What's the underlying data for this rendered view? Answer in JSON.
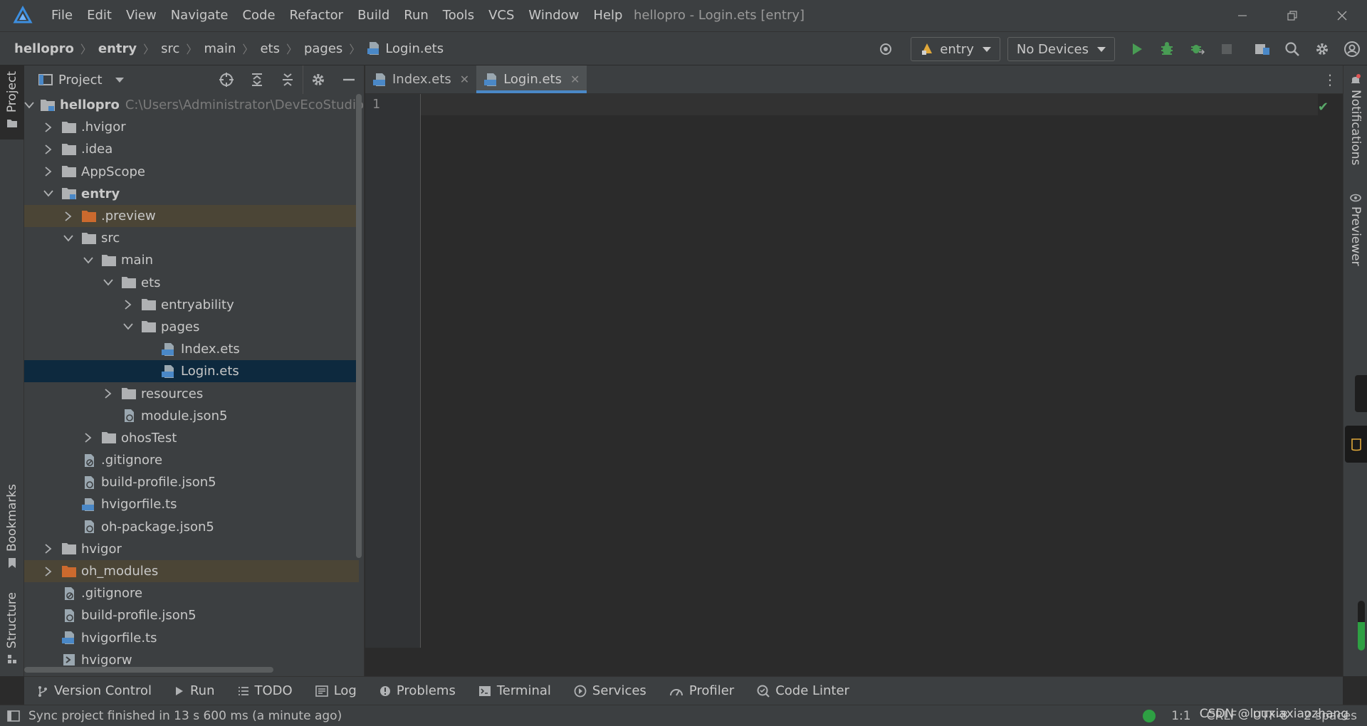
{
  "app": {
    "window_title": "hellopro - Login.ets [entry]",
    "menu": [
      "File",
      "Edit",
      "View",
      "Navigate",
      "Code",
      "Refactor",
      "Build",
      "Run",
      "Tools",
      "VCS",
      "Window",
      "Help"
    ]
  },
  "breadcrumb": {
    "items": [
      "hellopro",
      "entry",
      "src",
      "main",
      "ets",
      "pages",
      "Login.ets"
    ]
  },
  "toolbar": {
    "module_combo": "entry",
    "device_combo": "No Devices",
    "icons": [
      "locate-icon",
      "run-icon",
      "debug-icon",
      "attach-debugger-icon",
      "stop-icon",
      "project-structure-icon",
      "search-icon",
      "settings-icon",
      "account-icon"
    ],
    "colors": {
      "run": "#499c54",
      "accent": "#4a88c7"
    }
  },
  "left_strip": {
    "project": "Project",
    "bookmarks": "Bookmarks",
    "structure": "Structure"
  },
  "right_strip": {
    "notifications": "Notifications",
    "previewer": "Previewer"
  },
  "project_panel": {
    "title": "Project",
    "tree": [
      {
        "label": "hellopro",
        "path": "C:\\Users\\Administrator\\DevEcoStudioProjects\\hellopro",
        "type": "module",
        "expanded": true,
        "bold": true
      },
      {
        "label": ".hvigor",
        "type": "folder",
        "expanded": false
      },
      {
        "label": ".idea",
        "type": "folder",
        "expanded": false
      },
      {
        "label": "AppScope",
        "type": "folder",
        "expanded": false
      },
      {
        "label": "entry",
        "type": "module",
        "expanded": true,
        "bold": true
      },
      {
        "label": ".preview",
        "type": "folder-orange",
        "expanded": false
      },
      {
        "label": "src",
        "type": "folder",
        "expanded": true
      },
      {
        "label": "main",
        "type": "folder",
        "expanded": true
      },
      {
        "label": "ets",
        "type": "folder",
        "expanded": true
      },
      {
        "label": "entryability",
        "type": "folder",
        "expanded": false
      },
      {
        "label": "pages",
        "type": "folder",
        "expanded": true
      },
      {
        "label": "Index.ets",
        "type": "ets-file"
      },
      {
        "label": "Login.ets",
        "type": "ets-file"
      },
      {
        "label": "resources",
        "type": "folder",
        "expanded": false
      },
      {
        "label": "module.json5",
        "type": "json-file"
      },
      {
        "label": "ohosTest",
        "type": "folder",
        "expanded": false
      },
      {
        "label": ".gitignore",
        "type": "ignore-file"
      },
      {
        "label": "build-profile.json5",
        "type": "json-file"
      },
      {
        "label": "hvigorfile.ts",
        "type": "ts-file"
      },
      {
        "label": "oh-package.json5",
        "type": "json-file"
      },
      {
        "label": "hvigor",
        "type": "folder",
        "expanded": false
      },
      {
        "label": "oh_modules",
        "type": "folder-orange",
        "expanded": false
      },
      {
        "label": ".gitignore",
        "type": "ignore-file"
      },
      {
        "label": "build-profile.json5",
        "type": "json-file"
      },
      {
        "label": "hvigorfile.ts",
        "type": "ts-file"
      },
      {
        "label": "hvigorw",
        "type": "exec-file"
      }
    ]
  },
  "editor": {
    "tabs": [
      {
        "label": "Index.ets",
        "active": false
      },
      {
        "label": "Login.ets",
        "active": true
      }
    ],
    "line_numbers": [
      "1"
    ]
  },
  "bottom_tools": [
    "Version Control",
    "Run",
    "TODO",
    "Log",
    "Problems",
    "Terminal",
    "Services",
    "Profiler",
    "Code Linter"
  ],
  "status": {
    "message": "Sync project finished in 13 s 600 ms (a minute ago)",
    "position": "1:1",
    "line_sep": "CRLF",
    "encoding": "UTF-8",
    "indent": "2 spaces",
    "watermark": "CSDN @louxiaxiaozhang"
  }
}
